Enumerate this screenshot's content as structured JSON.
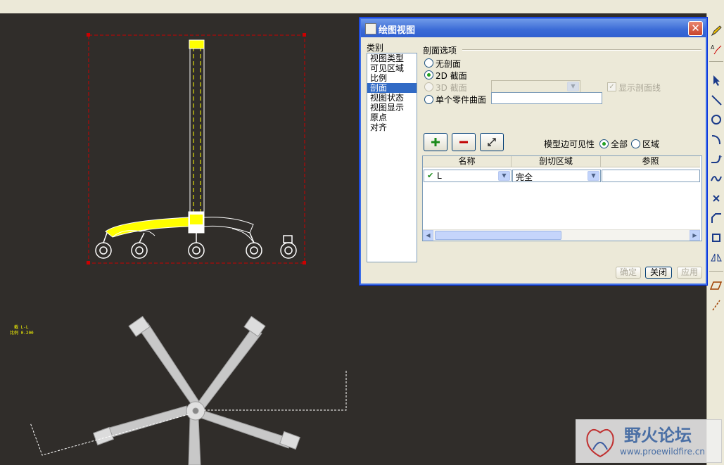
{
  "dialog": {
    "title": "绘图视图",
    "category_label": "类别",
    "categories": [
      "视图类型",
      "可见区域",
      "比例",
      "剖面",
      "视图状态",
      "视图显示",
      "原点",
      "对齐"
    ],
    "selected_category": "剖面",
    "section_options_label": "剖面选项",
    "radio_none": "无剖面",
    "radio_2d": "2D 截面",
    "radio_3d": "3D 截面",
    "radio_single": "单个零件曲面",
    "show_hatch": "显示剖面线",
    "edge_visibility_label": "模型边可见性",
    "radio_full": "全部",
    "radio_area": "区域",
    "columns": [
      "名称",
      "剖切区域",
      "参照"
    ],
    "row": {
      "name": "L",
      "area": "完全",
      "ref": ""
    },
    "ok": "确定",
    "close": "关闭",
    "apply": "应用"
  },
  "canvas": {
    "label_line1": "截 L-L",
    "label_line2": "比例 0.200"
  },
  "watermark": {
    "name": "野火论坛",
    "url": "www.proewildfire.cn"
  },
  "colors": {
    "canvas_bg": "#302d2a",
    "accent_yellow": "#ffff00",
    "frame_red": "#cc0000",
    "dialog_title": "#3a6ad6"
  },
  "icons": [
    "pencil-icon",
    "text-edit-icon",
    "select-arrow-icon",
    "line-icon",
    "circle-icon",
    "arc-icon",
    "fillet-icon",
    "spline-icon",
    "point-icon",
    "chamfer-icon",
    "rectangle-icon",
    "mirror-icon",
    "parallelogram-icon",
    "dashed-line-icon"
  ]
}
